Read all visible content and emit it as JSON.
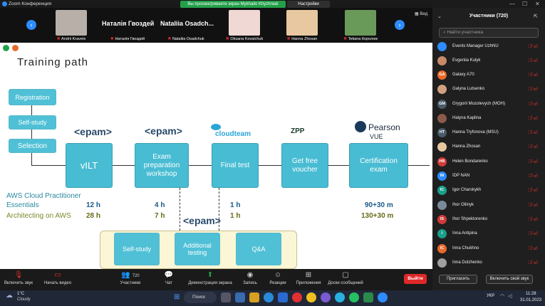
{
  "window": {
    "title": "Zoom Конференция",
    "share_banner": "Вы просматриваете экран Mykhailo Khyzhniak",
    "view_options": "Настройки просмотра"
  },
  "gallery": {
    "view_label": "Вид",
    "tiles": [
      {
        "caption": "Andrii Kravets",
        "big_name": "",
        "photo_color": "#b8b0a8"
      },
      {
        "caption": "Наталія Гвоздей",
        "big_name": "Наталія Гвоздей",
        "photo_color": ""
      },
      {
        "caption": "Nataliia Osadchuk",
        "big_name": "Nataliia Osadch...",
        "photo_color": ""
      },
      {
        "caption": "Oksana Kovalchuk",
        "big_name": "",
        "photo_color": "#f0d8d4"
      },
      {
        "caption": "Hanna Zhosan",
        "big_name": "",
        "photo_color": "#e8c8a0"
      },
      {
        "caption": "Tetiana Королюк",
        "big_name": "",
        "photo_color": "#6a9a5a"
      }
    ]
  },
  "slide": {
    "title": "Training path",
    "left_steps": [
      "Registration",
      "Self-study",
      "Selection"
    ],
    "main_steps": [
      "vILT",
      "Exam preparation workshop",
      "Final test",
      "Get free voucher",
      "Certification exam"
    ],
    "logos": {
      "epam": "<epam>",
      "cloudteam": "cloudteam",
      "zpp": "ZPP",
      "pearson": "Pearson",
      "pearson_sub": "VUE"
    },
    "courses": [
      {
        "name_line1": "AWS Cloud Practitioner",
        "name_line2": "Essentials",
        "vilt": "12 h",
        "workshop": "4 h",
        "final": "1 h",
        "cert": "90+30 m"
      },
      {
        "name_line1": "",
        "name_line2": "Architecting on AWS",
        "vilt": "28 h",
        "workshop": "7 h",
        "final": "1 h",
        "cert": "130+30 m"
      }
    ],
    "bottom_steps": [
      "Self-study",
      "Additional testing",
      "Q&A"
    ]
  },
  "participants": {
    "title": "Участники (720)",
    "search_placeholder": "Найти участника",
    "list": [
      {
        "name": "Events Manager UzhNU",
        "initials": "",
        "color": "#2d8cff"
      },
      {
        "name": "Evgeniia Kulyk",
        "initials": "",
        "color": "#c98a6a"
      },
      {
        "name": "Galaxy A70",
        "initials": "GA",
        "color": "#e86a2a"
      },
      {
        "name": "Galyna Lutsenko",
        "initials": "",
        "color": "#d0a080"
      },
      {
        "name": "Grygorii Mozolevych (МОН)",
        "initials": "GM",
        "color": "#4a5a6a"
      },
      {
        "name": "Halyna Kaplina",
        "initials": "",
        "color": "#8a5a4a"
      },
      {
        "name": "Hanna Tryfonova (MSU)",
        "initials": "HT",
        "color": "#4a5a6a"
      },
      {
        "name": "Hanna Zhosan",
        "initials": "",
        "color": "#e8c8a0"
      },
      {
        "name": "Helen Bondarenko",
        "initials": "HB",
        "color": "#d03a3a"
      },
      {
        "name": "IDP NAN",
        "initials": "IN",
        "color": "#2d8cff"
      },
      {
        "name": "Igor Charskykh",
        "initials": "IC",
        "color": "#1aa08a"
      },
      {
        "name": "Ihor Oliinyk",
        "initials": "",
        "color": "#7a8a9a"
      },
      {
        "name": "Ihor Shpektorenko",
        "initials": "IS",
        "color": "#d03a3a"
      },
      {
        "name": "Inna Antipina",
        "initials": "I",
        "color": "#1aa08a"
      },
      {
        "name": "Inna Chukhno",
        "initials": "IC",
        "color": "#e86a2a"
      },
      {
        "name": "Inna Dolzhenko",
        "initials": "",
        "color": "#a0a0a0"
      }
    ],
    "invite_label": "Пригласить",
    "unmute_label": "Включить свой звук"
  },
  "toolbar": {
    "audio": "Включить звук",
    "video": "Начать видео",
    "participants": "Участники",
    "participants_count": "720",
    "chat": "Чат",
    "share": "Демонстрация экрана",
    "record": "Запись",
    "reactions": "Реакции",
    "apps": "Приложения",
    "whiteboard": "Доски сообщений",
    "leave": "Выйти"
  },
  "taskbar": {
    "weather_temp": "1°C",
    "weather_desc": "Cloudy",
    "search": "Поиск",
    "lang": "УКР",
    "time": "11:28",
    "date": "31.01.2023"
  }
}
